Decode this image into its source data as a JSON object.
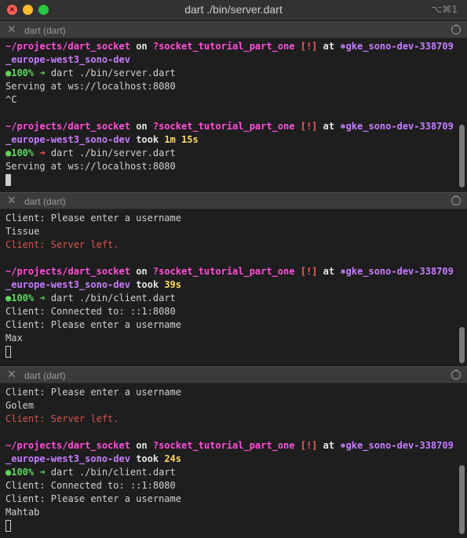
{
  "window": {
    "title": "dart ./bin/server.dart",
    "shortcut": "⌥⌘1"
  },
  "icons": [
    "close-icon",
    "minimize-icon",
    "maximize-icon",
    "close-pane-icon",
    "more-options-icon"
  ],
  "colors": {
    "background": "#1e1e1e",
    "path": "#ff4fd8",
    "error": "#d9534f",
    "ok": "#5fd75f",
    "duration": "#ffd866",
    "context": "#c77dff"
  },
  "prompt": {
    "path": "~/projects/dart_socket",
    "on": "on",
    "branch": "?socket_tutorial_part_one",
    "bang": "[!]",
    "at": "at",
    "ctx": "⎈gke_sono-dev-338709",
    "ctx_cont": "_europe-west3_sono-dev",
    "took": "took",
    "battery": "●100%",
    "arrow": "➜"
  },
  "panes": [
    {
      "title": "dart (dart)",
      "lines": {
        "cmd1": "dart ./bin/server.dart",
        "out1": "Serving at ws://localhost:8080",
        "out2": "^C",
        "took_value": "1m 15s",
        "cmd2": "dart ./bin/server.dart",
        "out3": "Serving at ws://localhost:8080"
      }
    },
    {
      "title": "dart (dart)",
      "lines": {
        "out1": "Client: Please enter a username",
        "out2": "Tissue",
        "err1": "Client: Server left.",
        "took_value": "39s",
        "cmd": "dart ./bin/client.dart",
        "out3": "Client: Connected to: ::1:8080",
        "out4": "Client: Please enter a username",
        "out5": "Max"
      }
    },
    {
      "title": "dart (dart)",
      "lines": {
        "out1": "Client: Please enter a username",
        "out2": "Golem",
        "err1": "Client: Server left.",
        "took_value": "24s",
        "cmd": "dart ./bin/client.dart",
        "out3": "Client: Connected to: ::1:8080",
        "out4": "Client: Please enter a username",
        "out5": "Mahtab"
      }
    }
  ]
}
